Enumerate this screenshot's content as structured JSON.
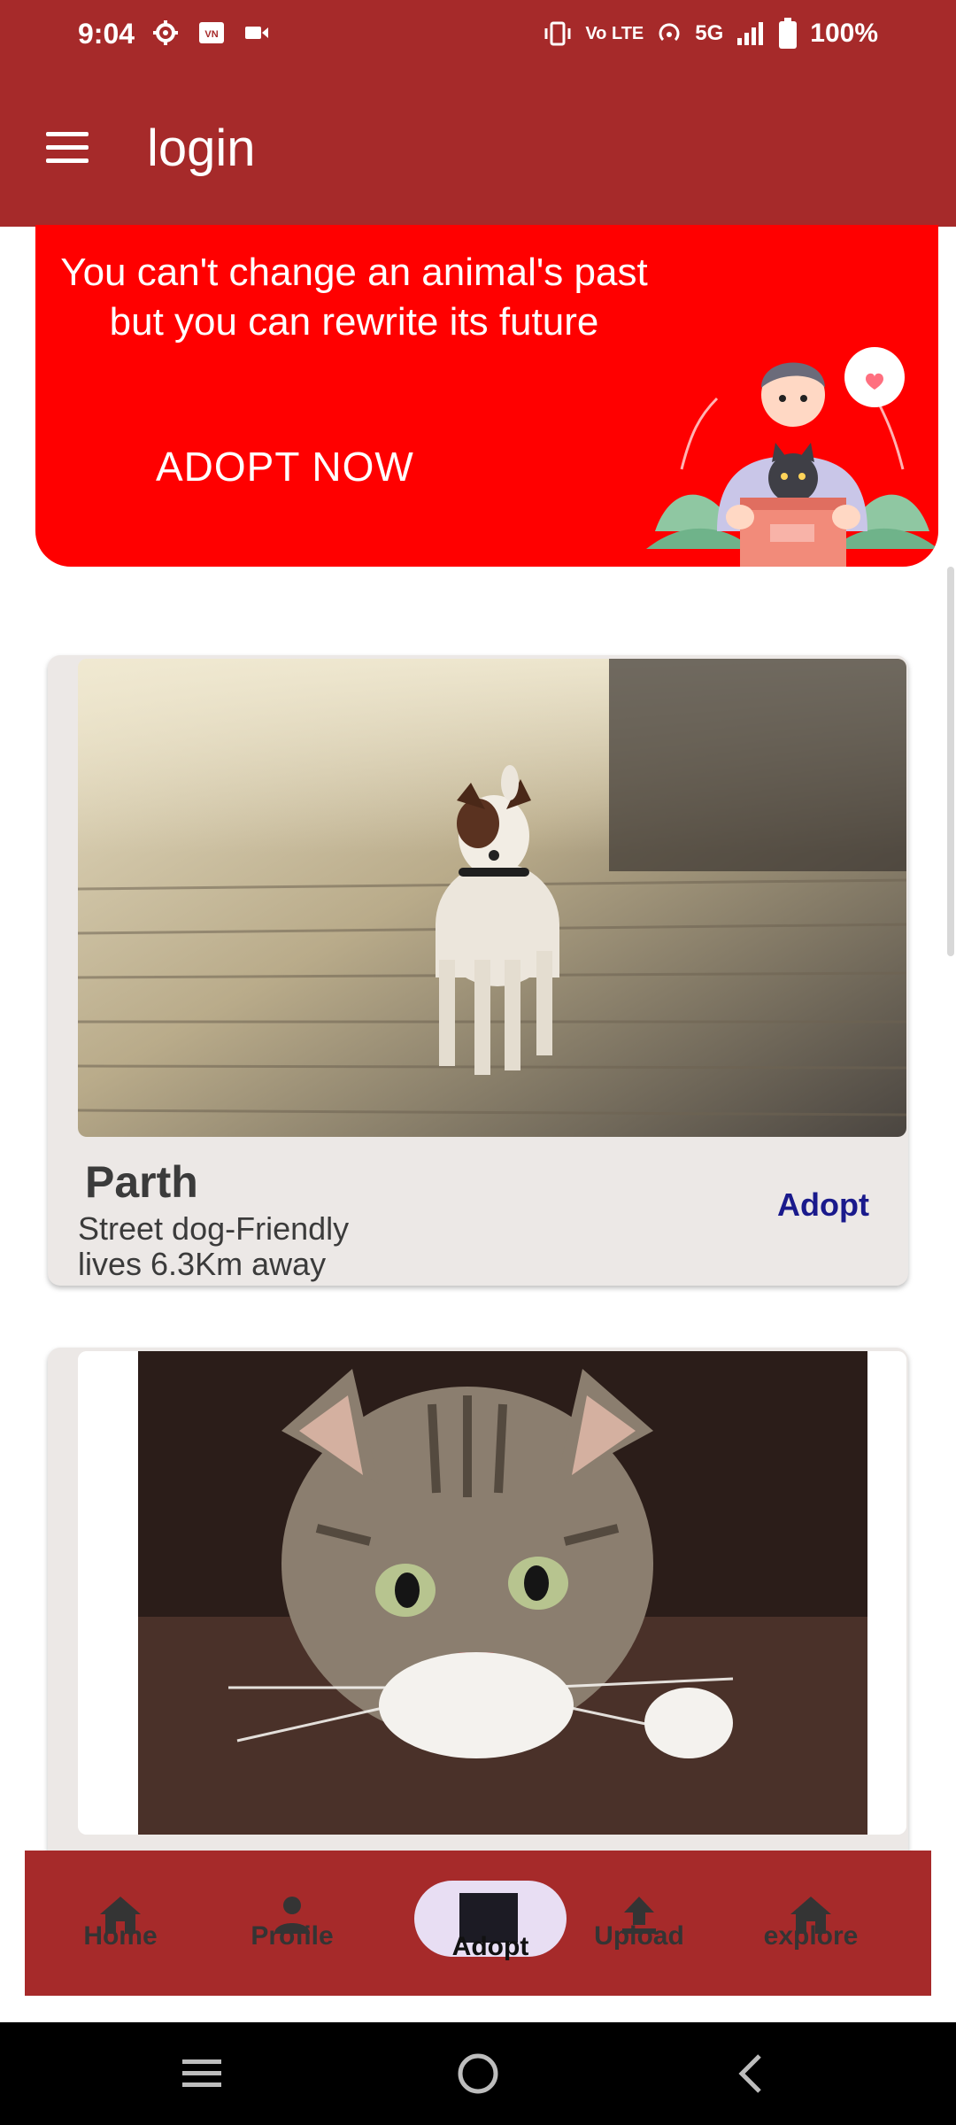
{
  "status_bar": {
    "time": "9:04",
    "left_icons": [
      "settings-icon",
      "vn-icon",
      "video-icon"
    ],
    "network_label": "5G",
    "volte_label": "Vo LTE",
    "battery": "100%"
  },
  "app_bar": {
    "title": "login",
    "menu_icon": "hamburger-menu-icon"
  },
  "banner": {
    "quote": "You can't change an animal's past but you can rewrite its future",
    "cta": "ADOPT NOW",
    "background_color": "#ff0000"
  },
  "pets": [
    {
      "name": "Parth",
      "description": "Street dog-Friendly",
      "distance": "lives 6.3Km away",
      "action": "Adopt"
    },
    {
      "name": "",
      "description": "",
      "distance": "",
      "action": ""
    }
  ],
  "bottom_nav": {
    "items": [
      {
        "label": "Home",
        "icon": "home-icon"
      },
      {
        "label": "Profile",
        "icon": "person-icon"
      },
      {
        "label": "Adopt",
        "icon": "adopt-icon",
        "active": true
      },
      {
        "label": "Upload",
        "icon": "upload-icon"
      },
      {
        "label": "explore",
        "icon": "home-icon"
      }
    ],
    "background_color": "#a62a2a"
  },
  "colors": {
    "primary": "#a62a2a",
    "banner": "#ff0000",
    "card": "#ece8e6",
    "adopt_link": "#1a1a8c"
  }
}
